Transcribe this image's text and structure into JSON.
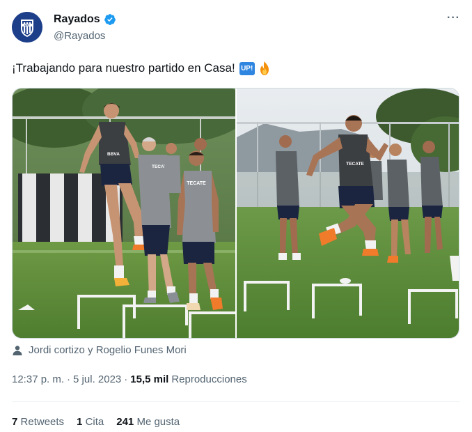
{
  "author": {
    "name": "Rayados",
    "handle": "@Rayados",
    "verified": true,
    "avatar_icon": "rayados-crest-icon"
  },
  "tweet": {
    "text": "¡Trabajando para nuestro partido en Casa!",
    "emoji_badge": "UP!",
    "emoji_fire": "fire-emoji"
  },
  "media": {
    "photo1_jersey_texts": [
      "BBVA",
      "TECATE"
    ],
    "photo2_jersey_texts": [
      "TECATE"
    ]
  },
  "tagged": {
    "text": "Jordi cortizo y Rogelio Funes Mori"
  },
  "meta": {
    "time": "12:37 p. m.",
    "separator": "·",
    "date": "5 jul. 2023",
    "views_count": "15,5 mil",
    "views_label": "Reproducciones"
  },
  "stats": {
    "retweets_count": "7",
    "retweets_label": "Retweets",
    "quotes_count": "1",
    "quotes_label": "Cita",
    "likes_count": "241",
    "likes_label": "Me gusta"
  },
  "colors": {
    "text": "#0f1419",
    "secondary": "#536471",
    "verified": "#1d9bf0",
    "divider": "#eff3f4"
  }
}
